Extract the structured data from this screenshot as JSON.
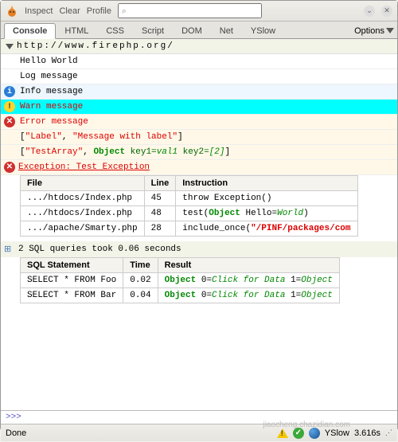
{
  "toolbar": {
    "inspect": "Inspect",
    "clear": "Clear",
    "profile": "Profile",
    "search_placeholder": ""
  },
  "tabs": {
    "items": [
      "Console",
      "HTML",
      "CSS",
      "Script",
      "DOM",
      "Net",
      "YSlow"
    ],
    "options": "Options"
  },
  "url": "http://www.firephp.org/",
  "messages": {
    "hello": "Hello World",
    "log": "Log message",
    "info": "Info message",
    "warn": "Warn message",
    "error": "Error message"
  },
  "label_row": {
    "open": "[",
    "label": "\"Label\"",
    "sep": ", ",
    "msg": "\"Message with label\"",
    "close": "]"
  },
  "array_row": {
    "open": "[",
    "label": "\"TestArray\"",
    "sep": ", ",
    "obj": "Object ",
    "k1": "key1=",
    "v1": "val1",
    "k2": " key2=",
    "v2": "[2]",
    "close": "]"
  },
  "exception": "Exception: Test Exception",
  "trace": {
    "headers": [
      "File",
      "Line",
      "Instruction"
    ],
    "rows": [
      {
        "file": ".../htdocs/Index.php",
        "line": "45",
        "instr": "throw Exception()"
      },
      {
        "file": ".../htdocs/Index.php",
        "line": "48",
        "instr_pre": "test(",
        "obj": "Object ",
        "k": "Hello=",
        "v": "World",
        "instr_post": ")"
      },
      {
        "file": ".../apache/Smarty.php",
        "line": "28",
        "instr_pre": "include_once(",
        "path": "\"/PINF/packages/com"
      }
    ]
  },
  "sql": {
    "summary": "2 SQL queries took 0.06 seconds",
    "headers": [
      "SQL Statement",
      "Time",
      "Result"
    ],
    "rows": [
      {
        "stmt": "SELECT * FROM Foo",
        "time": "0.02",
        "obj": "Object ",
        "r": "0=",
        "rv": "Click for Data ",
        "r2": "1=",
        "rv2": "Object"
      },
      {
        "stmt": "SELECT * FROM Bar",
        "time": "0.04",
        "obj": "Object ",
        "r": "0=",
        "rv": "Click for Data ",
        "r2": "1=",
        "rv2": "Object"
      }
    ]
  },
  "cmdline": ">>>",
  "status": {
    "done": "Done",
    "yslow": "YSlow",
    "time": "3.616s"
  }
}
